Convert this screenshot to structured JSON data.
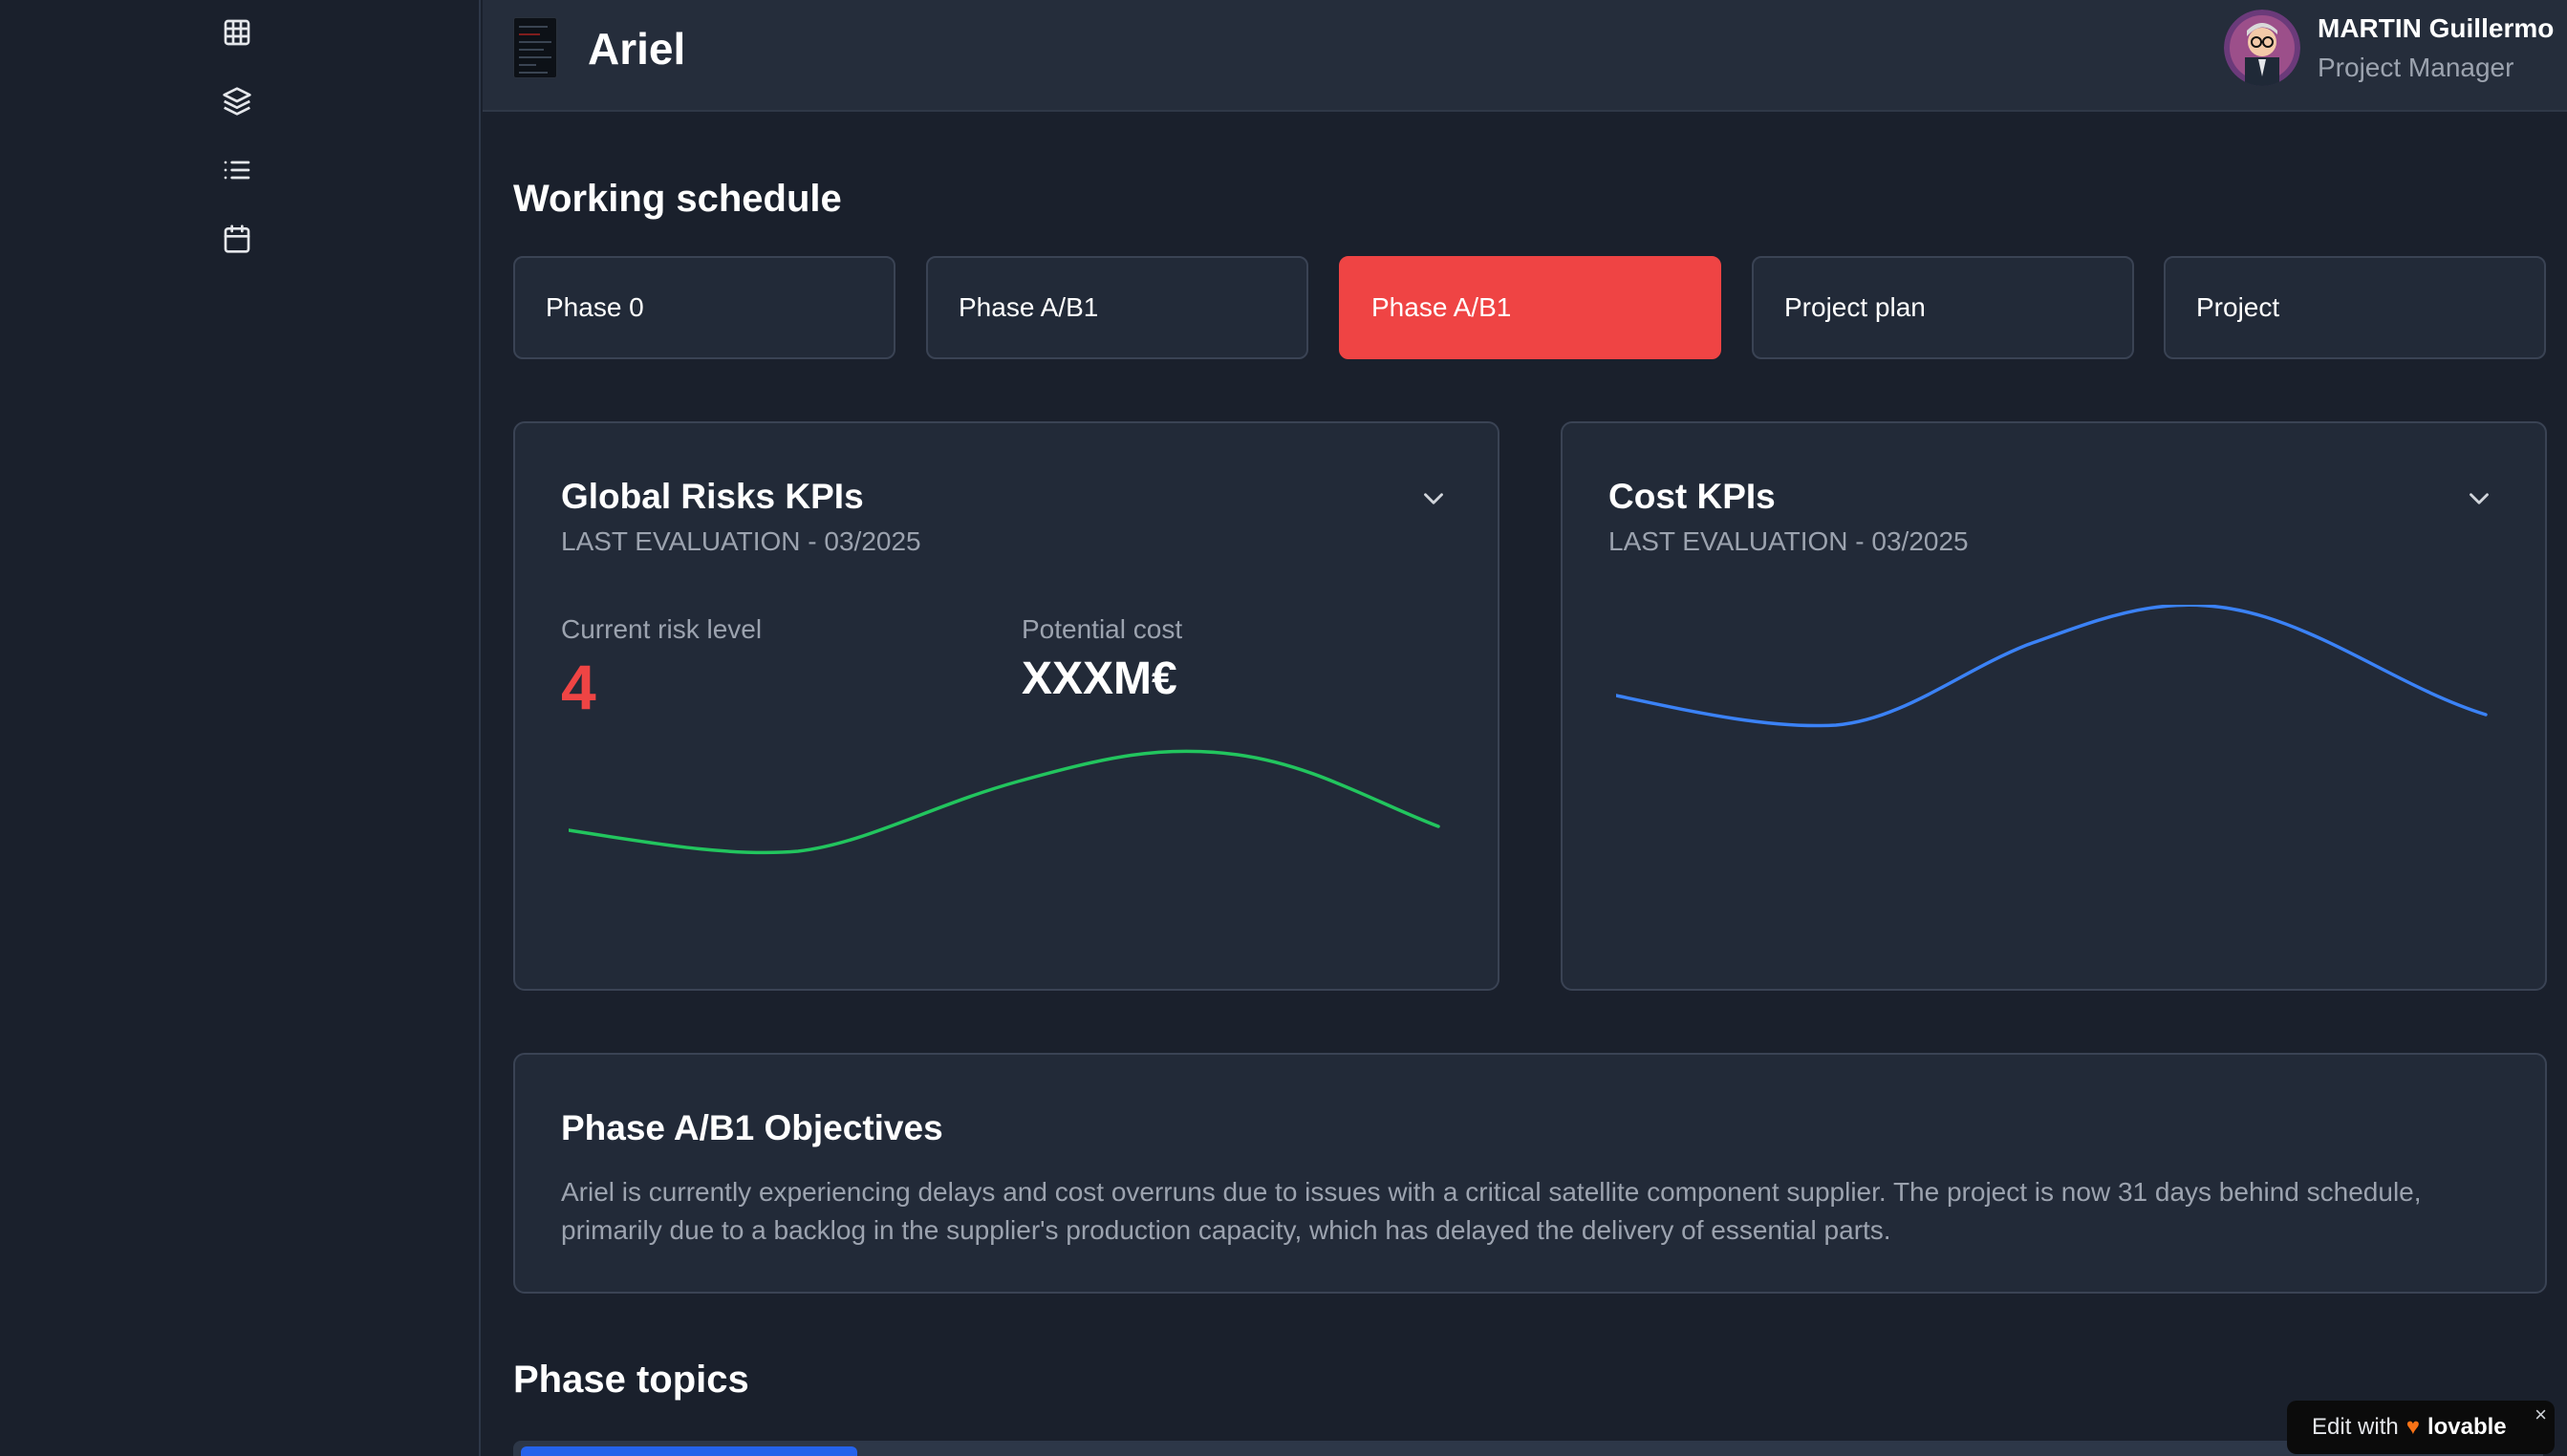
{
  "app": {
    "title": "Ariel"
  },
  "user": {
    "name": "MARTIN Guillermo",
    "role": "Project Manager"
  },
  "sidebar": {
    "icons": [
      "grid-icon",
      "layers-icon",
      "list-icon",
      "calendar-icon"
    ]
  },
  "schedule": {
    "title": "Working schedule",
    "phases": [
      {
        "label": "Phase 0",
        "active": false
      },
      {
        "label": "Phase A/B1",
        "active": false
      },
      {
        "label": "Phase A/B1",
        "active": true
      },
      {
        "label": "Project plan",
        "active": false
      },
      {
        "label": "Project",
        "active": false
      }
    ]
  },
  "risks_card": {
    "title": "Global Risks KPIs",
    "subtitle": "LAST EVALUATION - 03/2025",
    "risk_label": "Current risk level",
    "risk_value": "4",
    "cost_label": "Potential cost",
    "cost_value": "XXXM€",
    "line_color": "#22c55e"
  },
  "cost_card": {
    "title": "Cost KPIs",
    "subtitle": "LAST EVALUATION - 03/2025",
    "line_color": "#3b82f6"
  },
  "objectives": {
    "title": "Phase A/B1 Objectives",
    "text": "Ariel is currently experiencing delays and cost overruns due to issues with a critical satellite component supplier. The project is now 31 days behind schedule, primarily due to a backlog in the supplier's production capacity, which has delayed the delivery of essential parts."
  },
  "topics": {
    "title": "Phase topics"
  },
  "badge": {
    "edit_label": "Edit with",
    "brand": "lovable",
    "close": "×"
  },
  "colors": {
    "accent_red": "#ef4444",
    "background": "#1a202c",
    "card": "#222a38"
  }
}
